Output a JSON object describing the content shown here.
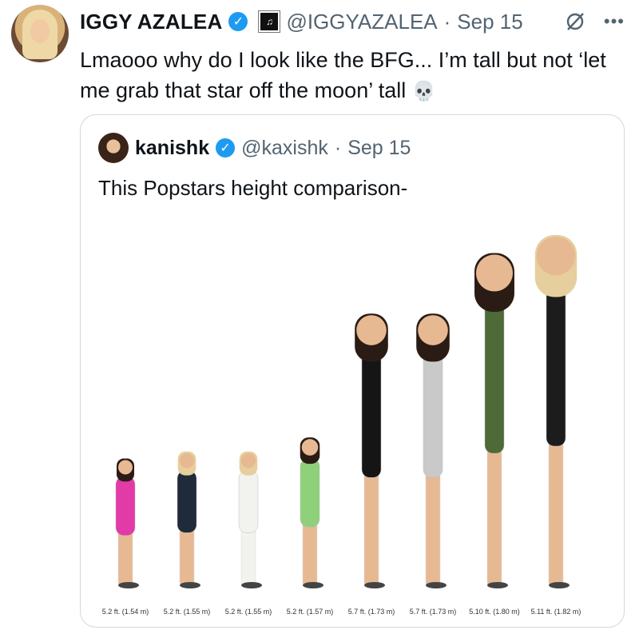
{
  "tweet": {
    "author_name": "IGGY AZALEA",
    "handle": "@IGGYAZALEA",
    "dot": "·",
    "date": "Sep 15",
    "text": "Lmaooo why do I look like the BFG... I’m tall but not ‘let me grab that star off the moon’ tall",
    "emoji": "💀",
    "icons": {
      "verified": "verified-badge-icon",
      "affiliate": "affiliate-badge-icon",
      "grok": "grok-icon",
      "more": "more-icon"
    }
  },
  "quote": {
    "author_name": "kanishk",
    "handle": "@kaxishk",
    "dot": "·",
    "date": "Sep 15",
    "text": "This Popstars height comparison-"
  },
  "chart_data": {
    "type": "bar",
    "categories": [
      "5.2 ft. (1.54 m)",
      "5.2 ft. (1.55 m)",
      "5.2 ft. (1.55 m)",
      "5.2 ft. (1.57 m)",
      "5.7 ft. (1.73 m)",
      "5.7 ft. (1.73 m)",
      "5.10 ft. (1.80 m)",
      "5.11 ft. (1.82 m)"
    ],
    "values": [
      1.54,
      1.55,
      1.55,
      1.57,
      1.73,
      1.73,
      1.8,
      1.82
    ],
    "ylim": [
      0,
      1.82
    ],
    "colors": [
      "#e23aa7",
      "#1f2b3a",
      "#f2f2ee",
      "#8fd07a",
      "#151515",
      "#c9c9c9",
      "#4e6a36",
      "#1c1c1c"
    ],
    "skin": "#e7b993"
  }
}
